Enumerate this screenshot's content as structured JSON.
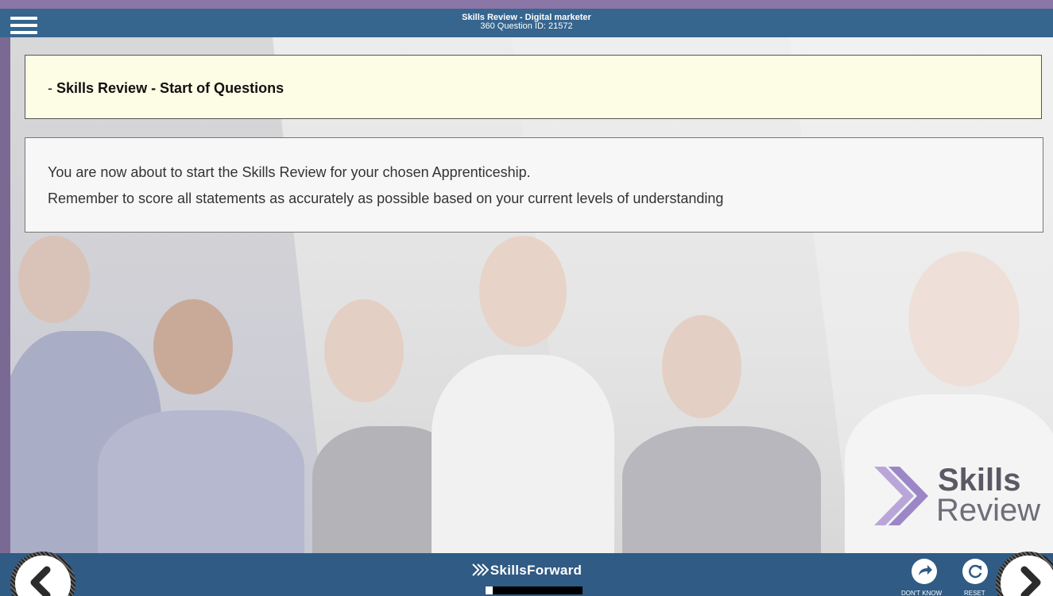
{
  "header": {
    "title": "Skills Review - Digital marketer",
    "subtitle": "360 Question ID: 21572"
  },
  "main": {
    "heading_prefix": "- ",
    "heading": "Skills Review - Start of Questions",
    "info_lines": [
      "You are now about to start the Skills Review for your chosen Apprenticeship.",
      "Remember to score all statements as accurately as possible based on your current levels of understanding"
    ]
  },
  "logo": {
    "line1": "Skills",
    "line2": "Review"
  },
  "footer": {
    "brand": "SkillsForward",
    "dont_know_label": "DON'T KNOW",
    "reset_label": "RESET",
    "progress_fraction": 0.07
  },
  "icons": {
    "menu": "hamburger-menu-icon",
    "prev": "chevron-left-icon",
    "next": "chevron-right-icon",
    "dont_know": "forward-arrow-icon",
    "reset": "refresh-icon"
  },
  "colors": {
    "header_bg": "#36658e",
    "footer_bg": "#2f5b84",
    "title_box_bg": "#fdfce5",
    "accent_purple": "#8a76a7"
  }
}
